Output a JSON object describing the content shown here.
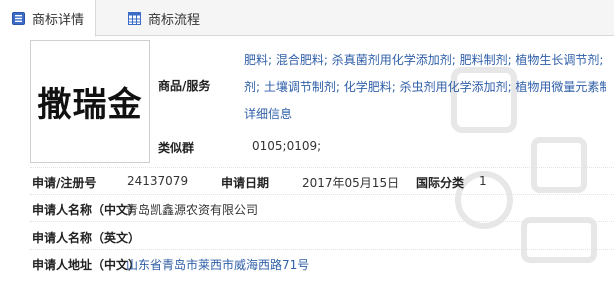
{
  "tabs": {
    "detail_label": "商标详情",
    "flow_label": "商标流程"
  },
  "logo": {
    "text": "撒瑞金"
  },
  "goods": {
    "label": "商品/服务",
    "line1": "肥料; 混合肥料; 杀真菌剂用化学添加剂; 肥料制剂; 植物生长调节剂; 防微生物",
    "line2": "剂; 土壤调节制剂; 化学肥料; 杀虫剂用化学添加剂; 植物用微量元素制剂; 查看",
    "more_link": "详细信息"
  },
  "similar_group": {
    "label": "类似群",
    "value": "0105;0109;"
  },
  "application": {
    "reg_label": "申请/注册号",
    "reg_value": "24137079",
    "date_label": "申请日期",
    "date_value": "2017年05月15日",
    "class_label": "国际分类",
    "class_value": "1"
  },
  "applicant_cn": {
    "label": "申请人名称（中文）",
    "value": "青岛凯鑫源农资有限公司"
  },
  "applicant_en": {
    "label": "申请人名称（英文）",
    "value": ""
  },
  "address_cn": {
    "label": "申请人地址（中文）",
    "value": "山东省青岛市莱西市威海西路71号"
  },
  "icons": {
    "detail_tab_icon": "document-list-icon",
    "flow_tab_icon": "grid-table-icon"
  },
  "colors": {
    "link_blue": "#2f5fa8",
    "tab_bar_bg": "#f5f5f5"
  }
}
